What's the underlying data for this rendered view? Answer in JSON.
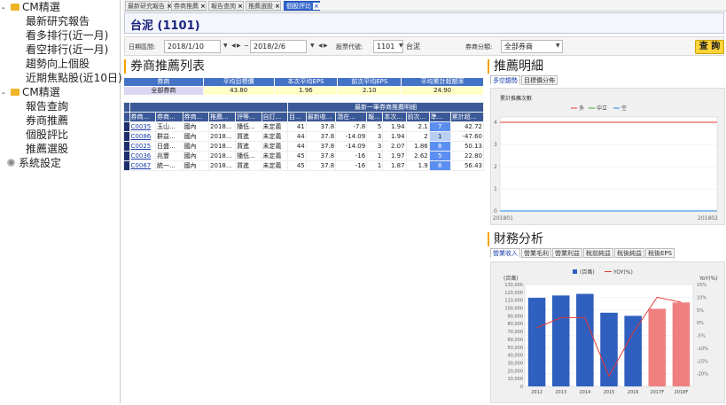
{
  "sidebar": {
    "sections": [
      {
        "label": "CM精選",
        "items": [
          "最新研究報告",
          "看多排行(近一月)",
          "看空排行(近一月)",
          "趨勢向上個股",
          "近期焦點股(近10日)"
        ]
      },
      {
        "label": "CM精選",
        "items": [
          "報告查詢",
          "券商推薦",
          "個股評比",
          "推薦選股"
        ]
      }
    ],
    "settings_label": "系統設定"
  },
  "tabs": [
    {
      "label": "最新研究報告",
      "close": "×"
    },
    {
      "label": "券商推薦",
      "close": "×"
    },
    {
      "label": "報告查詢",
      "close": "×"
    },
    {
      "label": "推薦選股",
      "close": "×"
    },
    {
      "label": "個股評比",
      "close": "×",
      "active": true
    }
  ],
  "stock": {
    "title": "台泥  (1101)"
  },
  "filter": {
    "date_label": "日期區間:",
    "date_from": "2018/1/10",
    "date_sep": "~",
    "date_to": "2018/2/6",
    "stock_code_label": "股票代號:",
    "stock_code": "1101",
    "stock_name": "台泥",
    "broker_cat_label": "券商分類:",
    "broker_cat": "全部券商",
    "query_button": "查 詢"
  },
  "broker_list": {
    "title": "券商推薦列表",
    "summary_headers": [
      "券商",
      "平均目標價",
      "本次平均EPS",
      "前次平均EPS",
      "平均累計超額率"
    ],
    "summary_row": [
      "全部券商",
      "43.80",
      "1.96",
      "2.10",
      "24.90"
    ],
    "group_header": "最新一筆券商推薦明細",
    "detail_headers": [
      "券商...",
      "券商...",
      "券商...",
      "推薦...",
      "評等...",
      "自訂...",
      "目...",
      "最新收...",
      "潛在...",
      "報...",
      "本次...",
      "前次...",
      "準...",
      "累計超..."
    ],
    "rows": [
      [
        "C0035",
        "玉山...",
        "國內",
        "2018...",
        "播低...",
        "未定義",
        "41",
        "37.8",
        "-7.8",
        "5",
        "1.94",
        "2.1",
        "7",
        "42.72"
      ],
      [
        "C0086",
        "群益...",
        "國內",
        "2018...",
        "買進",
        "未定義",
        "44",
        "37.8",
        "-14.09",
        "3",
        "1.94",
        "2",
        "1",
        "-47.60"
      ],
      [
        "C0025",
        "日盛...",
        "國內",
        "2018...",
        "買進",
        "未定義",
        "44",
        "37.8",
        "-14.09",
        "3",
        "2.07",
        "1.86",
        "8",
        "50.13"
      ],
      [
        "C0036",
        "兆豐",
        "國內",
        "2018...",
        "播低...",
        "未定義",
        "45",
        "37.8",
        "-16",
        "1",
        "1.97",
        "2.62",
        "5",
        "22.80"
      ],
      [
        "C0067",
        "統一...",
        "國內",
        "2018...",
        "買進",
        "未定義",
        "45",
        "37.8",
        "-16",
        "1",
        "1.87",
        "1.9",
        "8",
        "56.43"
      ]
    ]
  },
  "recommend_detail": {
    "title": "推薦明細",
    "subtabs": [
      "多空趨勢",
      "目標價分佈"
    ],
    "chart_title": "累計推薦次數",
    "legend": [
      "多",
      "中立",
      "空"
    ]
  },
  "financial": {
    "title": "財務分析",
    "subtabs": [
      "營業收入",
      "營業毛利",
      "營業利益",
      "稅前純益",
      "稅後純益",
      "稅後EPS"
    ]
  },
  "chart_data": [
    {
      "type": "line",
      "title": "累計推薦次數",
      "x": [
        "201801",
        "201802"
      ],
      "series": [
        {
          "name": "多",
          "values": [
            4,
            4
          ],
          "color": "#e53935"
        },
        {
          "name": "中立",
          "values": [
            0,
            0
          ],
          "color": "#43a047"
        },
        {
          "name": "空",
          "values": [
            0,
            0
          ],
          "color": "#1e88e5"
        }
      ],
      "ylim": [
        0,
        4
      ],
      "yticks": [
        0,
        1,
        2,
        3,
        4
      ],
      "legend_position": "top"
    },
    {
      "type": "bar",
      "categories": [
        "2012",
        "2013",
        "2014",
        "2015",
        "2016",
        "2017F",
        "2018F"
      ],
      "series": [
        {
          "name": "(百萬)",
          "values": [
            113000,
            116000,
            118000,
            94000,
            90000,
            99000,
            107000
          ],
          "colors": [
            "#2f5fbf",
            "#2f5fbf",
            "#2f5fbf",
            "#2f5fbf",
            "#2f5fbf",
            "#f08080",
            "#f08080"
          ]
        },
        {
          "name": "YOY(%)",
          "values": [
            -2,
            2,
            2,
            -21,
            -4,
            10,
            8
          ],
          "color": "#e53935",
          "axis": "right"
        }
      ],
      "ylabel_left": "(百萬)",
      "ylabel_right": "YoY(%)",
      "ylim": [
        0,
        130000
      ],
      "yticks_left": [
        "0",
        "10,000",
        "20,000",
        "30,000",
        "40,000",
        "50,000",
        "60,000",
        "70,000",
        "80,000",
        "90,000",
        "100,000",
        "110,000",
        "120,000",
        "130,000"
      ],
      "y2lim": [
        -25,
        15
      ],
      "yticks_right": [
        "15%",
        "10%",
        "5%",
        "0%",
        "-5%",
        "-10%",
        "-15%",
        "-20%"
      ],
      "legend_position": "top"
    }
  ]
}
